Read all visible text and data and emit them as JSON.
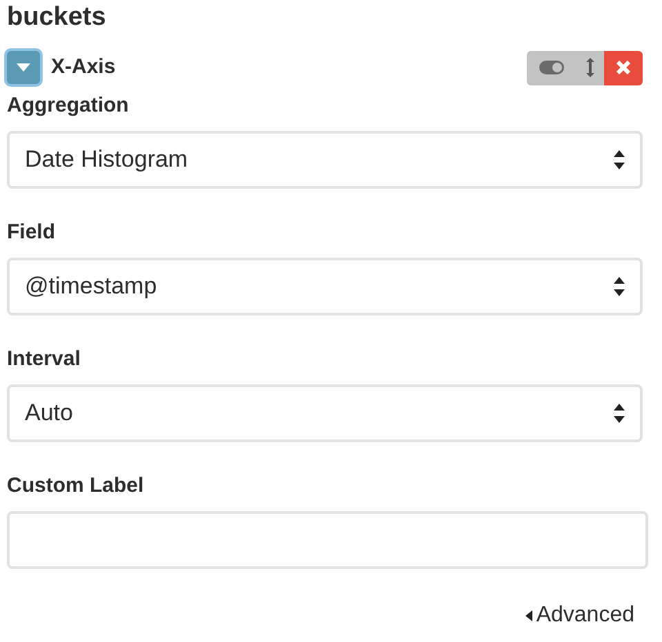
{
  "section_title": "buckets",
  "bucket": {
    "label": "X-Axis",
    "expanded": true
  },
  "fields": [
    {
      "label": "Aggregation",
      "kind": "select",
      "value": "Date Histogram"
    },
    {
      "label": "Field",
      "kind": "select",
      "value": "@timestamp"
    },
    {
      "label": "Interval",
      "kind": "select",
      "value": "Auto"
    },
    {
      "label": "Custom Label",
      "kind": "input"
    }
  ],
  "advanced_link": "Advanced"
}
